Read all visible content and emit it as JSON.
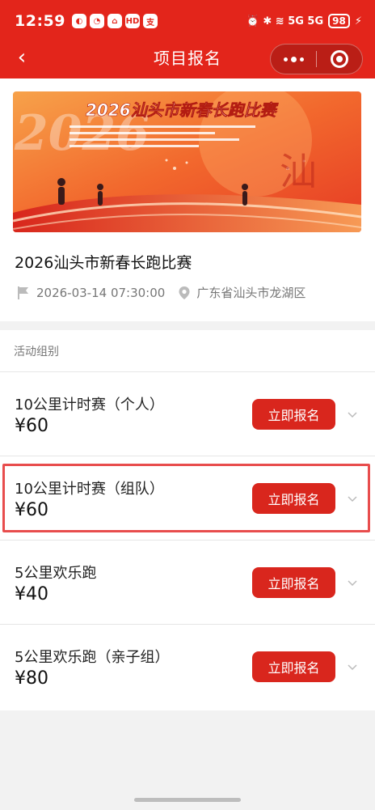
{
  "status_bar": {
    "time": "12:59",
    "app_icons": [
      "◐",
      "◔",
      "⌂",
      "HD",
      "支"
    ],
    "right_text": "⏰ ✱ ≋ 5G 5G",
    "battery": "98"
  },
  "navbar": {
    "title": "项目报名",
    "back_icon": "‹"
  },
  "event": {
    "banner_title": "2026汕头市新春长跑比赛",
    "banner_year": "2026",
    "banner_calligraphy": "汕",
    "title": "2026汕头市新春长跑比赛",
    "datetime": "2026-03-14 07:30:00",
    "location": "广东省汕头市龙湖区"
  },
  "groups": {
    "section_label": "活动组别",
    "button_label": "立即报名",
    "items": [
      {
        "name": "10公里计时赛（个人）",
        "price": "¥60"
      },
      {
        "name": "10公里计时赛（组队）",
        "price": "¥60"
      },
      {
        "name": "5公里欢乐跑",
        "price": "¥40"
      },
      {
        "name": "5公里欢乐跑（亲子组）",
        "price": "¥80"
      }
    ]
  },
  "colors": {
    "brand_red": "#e3251b",
    "button_red": "#d9261d",
    "highlight_border": "#e84d4d"
  }
}
